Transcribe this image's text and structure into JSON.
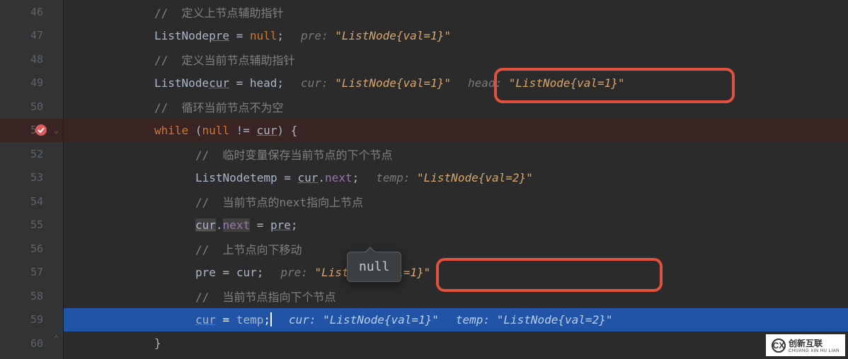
{
  "lines": [
    {
      "num": "46",
      "indent": 1,
      "type": "comment",
      "text": "//  定义上节点辅助指针"
    },
    {
      "num": "47",
      "indent": 1,
      "type": "decl",
      "kw": "ListNode",
      "var": "pre",
      "assign": " = ",
      "val": "null",
      "term": ";",
      "hint_name": "pre",
      "hint_val": "\"ListNode{val=1}\""
    },
    {
      "num": "48",
      "indent": 1,
      "type": "comment",
      "text": "//  定义当前节点辅助指针"
    },
    {
      "num": "49",
      "indent": 1,
      "type": "decl",
      "kw": "ListNode",
      "var": "cur",
      "assign": " = ",
      "val": "head",
      "term": ";",
      "hint_name": "cur",
      "hint_val": "\"ListNode{val=1}\"",
      "hint2_name": "head",
      "hint2_val": "\"ListNode{val=1}\""
    },
    {
      "num": "50",
      "indent": 1,
      "type": "comment",
      "text": "//  循环当前节点不为空"
    },
    {
      "num": "51",
      "indent": 1,
      "type": "while",
      "kw": "while",
      "paren": " (",
      "cond1": "null",
      "op": " != ",
      "cond2": "cur",
      "close": ") {",
      "bp": true,
      "fold": true
    },
    {
      "num": "52",
      "indent": 2,
      "type": "comment",
      "text": "//  临时变量保存当前节点的下个节点"
    },
    {
      "num": "53",
      "indent": 2,
      "type": "decl2",
      "kw": "ListNode",
      "var": "temp",
      "assign": " = ",
      "obj": "cur",
      "dot": ".",
      "prop": "next",
      "term": ";",
      "hint_name": "temp",
      "hint_val": "\"ListNode{val=2}\""
    },
    {
      "num": "54",
      "indent": 2,
      "type": "comment",
      "text": "//  当前节点的next指向上节点"
    },
    {
      "num": "55",
      "indent": 2,
      "type": "assign",
      "obj": "cur",
      "dot": ".",
      "prop": "next",
      "assign": " = ",
      "val": "pre",
      "term": ";"
    },
    {
      "num": "56",
      "indent": 2,
      "type": "comment",
      "text": "//  上节点向下移动"
    },
    {
      "num": "57",
      "indent": 2,
      "type": "assign2",
      "lhs": "pre",
      "assign": " = ",
      "rhs": "cur",
      "term": ";",
      "hint_name": "pre",
      "hint_val": "\"ListNode{val=1}\""
    },
    {
      "num": "58",
      "indent": 2,
      "type": "comment",
      "text": "//  当前节点指向下个节点"
    },
    {
      "num": "59",
      "indent": 2,
      "type": "exec",
      "lhs": "cur",
      "assign": " = ",
      "rhs": "temp",
      "term": ";",
      "hint_name": "cur",
      "hint_val": "\"ListNode{val=1}\"",
      "hint2_name": "temp",
      "hint2_val": "\"ListNode{val=2}\""
    },
    {
      "num": "60",
      "indent": 1,
      "type": "close",
      "text": "}",
      "fold": true
    }
  ],
  "tooltip": "null",
  "watermark": {
    "logo": "CX",
    "text": "创新互联",
    "sub": "CHUANG XIN HU LIAN"
  }
}
